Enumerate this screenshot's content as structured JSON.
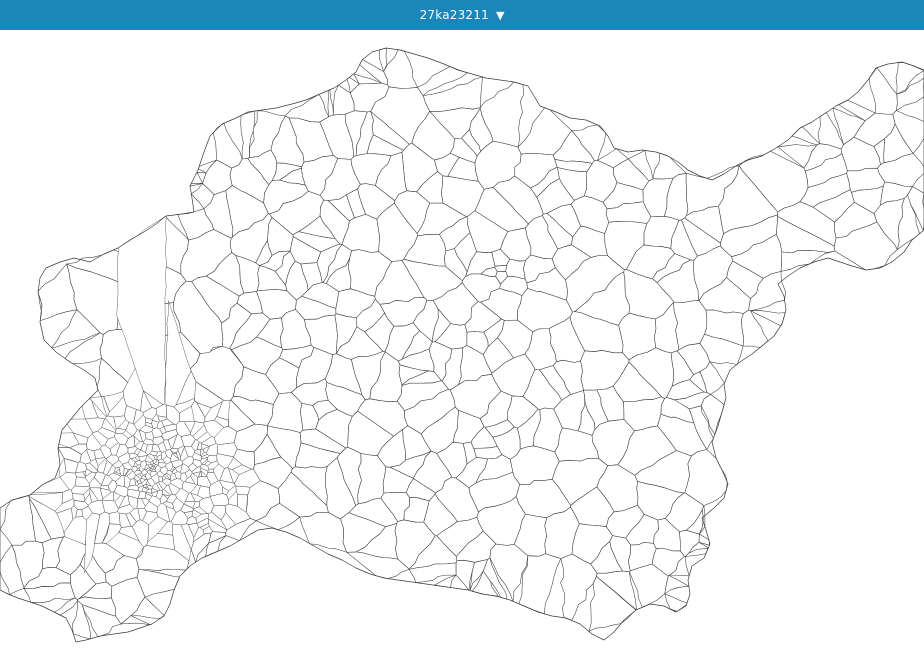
{
  "selector": {
    "label": "27ka23211",
    "caret_icon": "triangle-down-icon"
  },
  "map": {
    "fill_color": "#ffffff",
    "stroke_color": "#3a3a3a",
    "header_color": "#1a86b9"
  }
}
